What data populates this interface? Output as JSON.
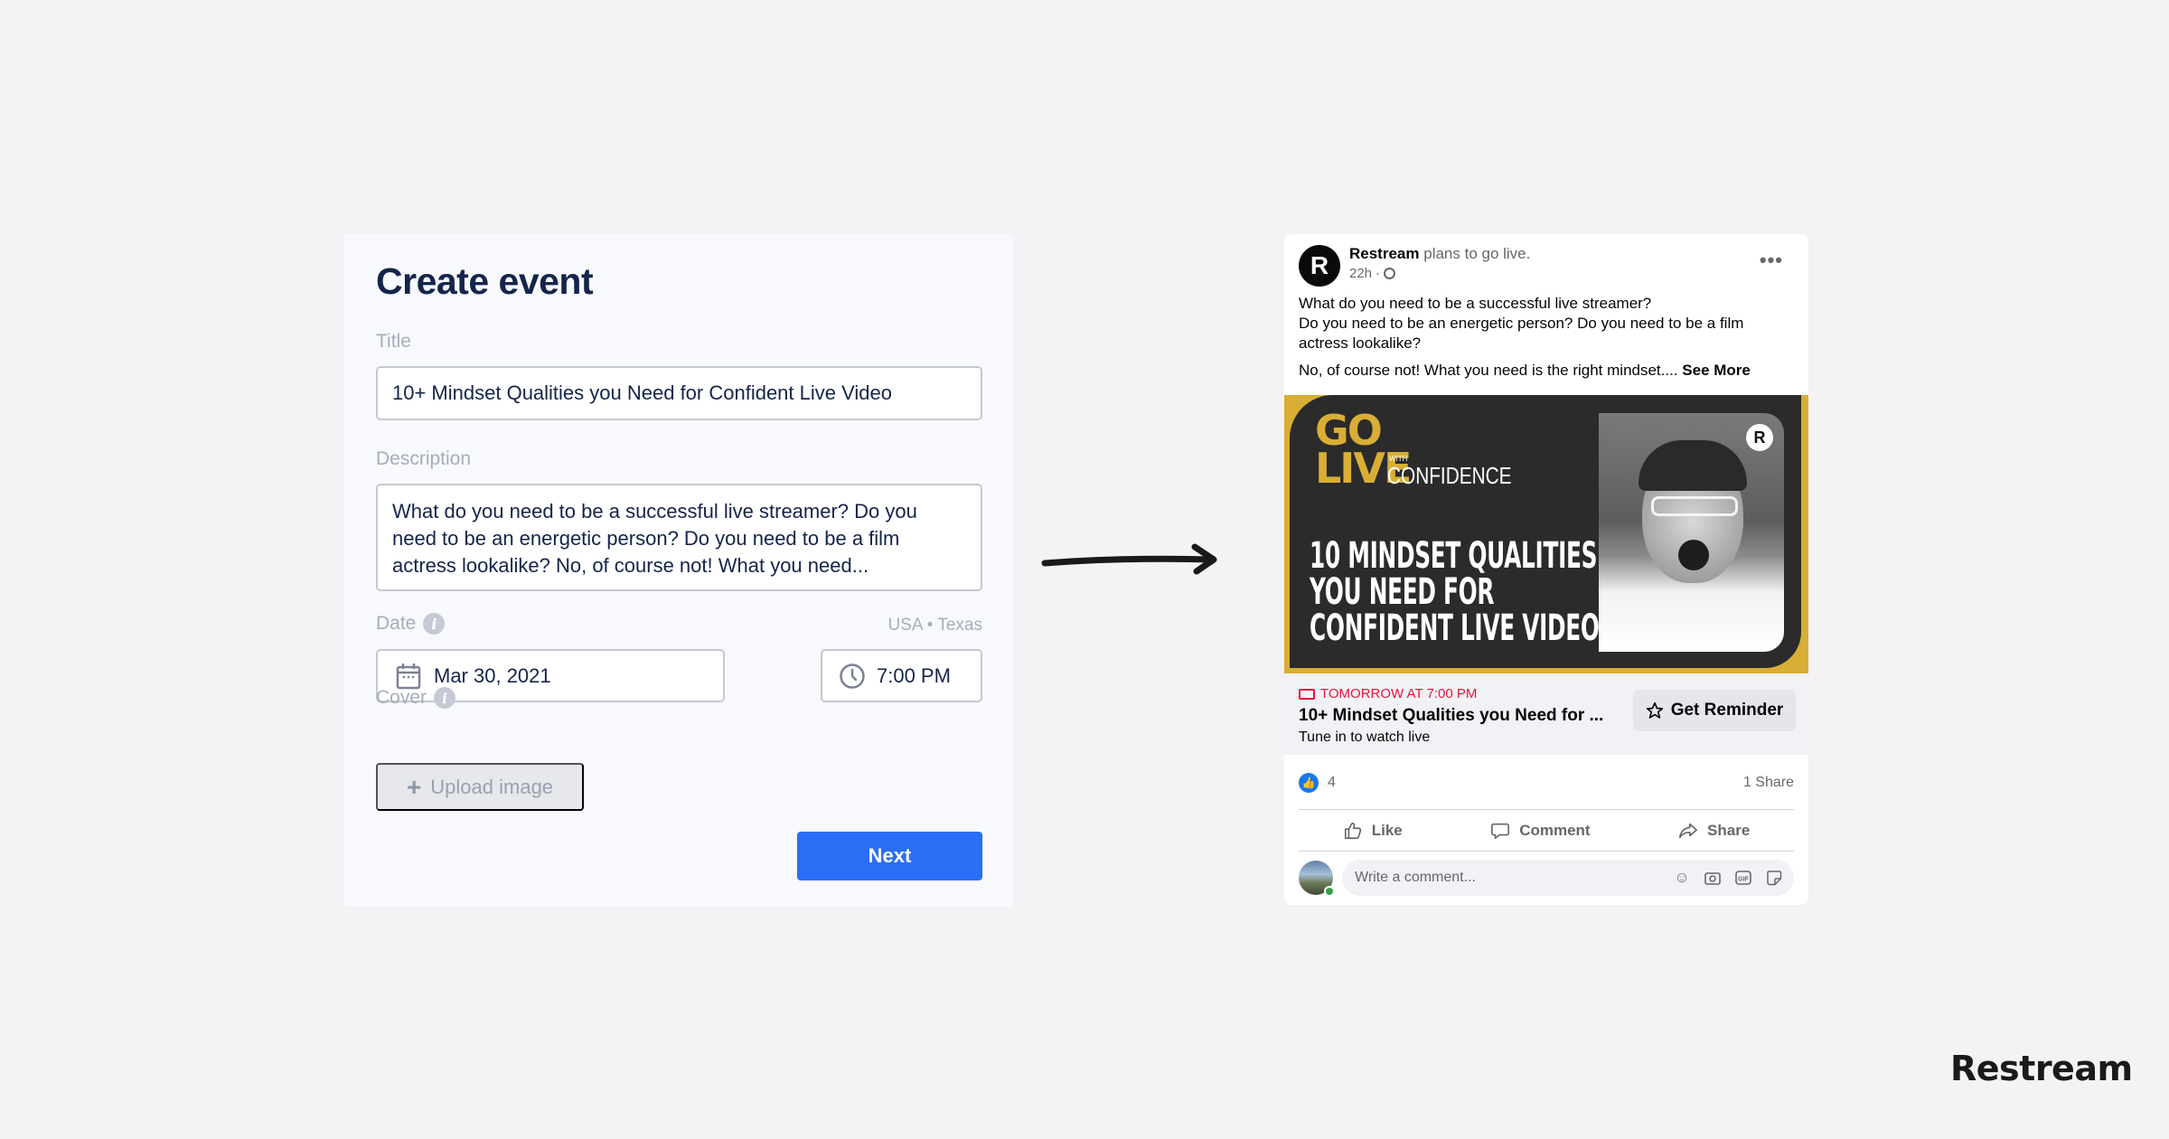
{
  "create_event": {
    "heading": "Create event",
    "title_label": "Title",
    "title_value": "10+ Mindset Qualities you Need for Confident Live Video",
    "description_label": "Description",
    "description_value": "What do you need to be a successful live streamer? Do you need to be an energetic person? Do you need to be a film actress lookalike? No, of course not! What you need...",
    "date_label": "Date",
    "region": "USA • Texas",
    "date_value": "Mar 30, 2021",
    "time_value": "7:00 PM",
    "cover_label": "Cover",
    "upload_label": "Upload image",
    "next_label": "Next",
    "accent_color": "#2a6ef5"
  },
  "post": {
    "author": "Restream",
    "action": "plans to go live.",
    "time_ago": "22h",
    "avatar_letter": "R",
    "text_lines": [
      "What do you need to be a successful live streamer?",
      "Do you need to be an energetic person? Do you need to be a film actress lookalike?"
    ],
    "text_more": "No, of course not! What you need is the right mindset....",
    "see_more": "See More",
    "thumbnail": {
      "go": "GO",
      "live": "LIVE",
      "with": "WITH",
      "confidence": "CONFIDENCE",
      "headline": [
        "10 MINDSET QUALITIES",
        "YOU NEED FOR",
        "CONFIDENT LIVE VIDEO"
      ],
      "badge": "R",
      "accent_color": "#d9ae35"
    },
    "event": {
      "when": "TOMORROW AT 7:00 PM",
      "title": "10+ Mindset Qualities you Need for ...",
      "subtitle": "Tune in to watch live",
      "reminder_label": "Get Reminder",
      "when_color": "#e4163a"
    },
    "stats": {
      "likes": "4",
      "shares": "1 Share"
    },
    "actions": [
      "Like",
      "Comment",
      "Share"
    ],
    "comment_placeholder": "Write a comment..."
  },
  "brand": "Restream"
}
